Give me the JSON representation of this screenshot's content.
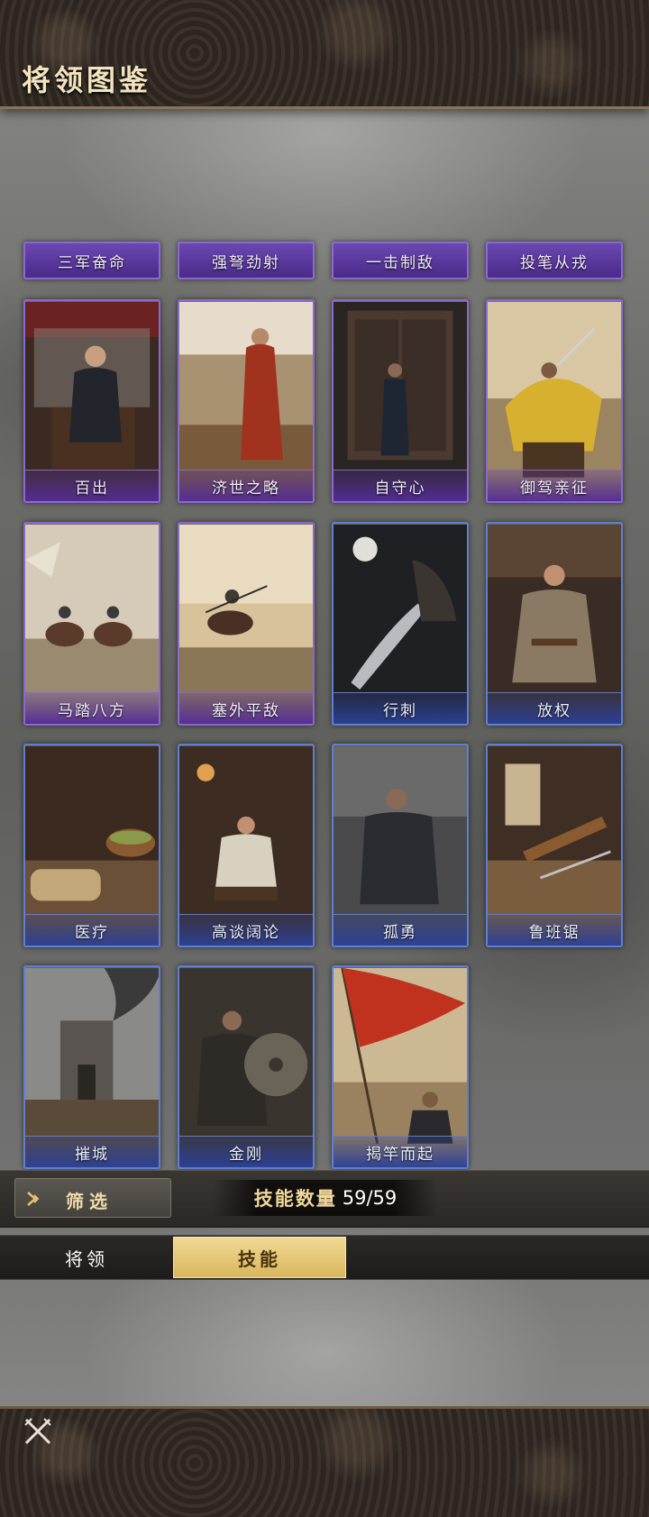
{
  "header": {
    "title": "将领图鉴"
  },
  "skills_partial_row": [
    {
      "name": "三军奋命",
      "tier": "purple"
    },
    {
      "name": "强弩劲射",
      "tier": "purple"
    },
    {
      "name": "一击制敌",
      "tier": "purple"
    },
    {
      "name": "投笔从戎",
      "tier": "purple"
    }
  ],
  "skills": [
    {
      "name": "百出",
      "tier": "purple",
      "art": "general-seated-tent"
    },
    {
      "name": "济世之略",
      "tier": "purple",
      "art": "strategist-overlooking-city"
    },
    {
      "name": "自守心",
      "tier": "purple",
      "art": "figure-before-wooden-door"
    },
    {
      "name": "御驾亲征",
      "tier": "purple",
      "art": "emperor-raising-sword"
    },
    {
      "name": "马踏八方",
      "tier": "purple",
      "art": "cavalry-charge"
    },
    {
      "name": "塞外平敌",
      "tier": "purple",
      "art": "rider-on-frontier"
    },
    {
      "name": "行刺",
      "tier": "blue",
      "art": "assassin-blade-moonlight"
    },
    {
      "name": "放权",
      "tier": "blue",
      "art": "official-in-hall"
    },
    {
      "name": "医疗",
      "tier": "blue",
      "art": "herbs-and-scrolls"
    },
    {
      "name": "高谈阔论",
      "tier": "blue",
      "art": "scholar-debating"
    },
    {
      "name": "孤勇",
      "tier": "blue",
      "art": "lone-warrior"
    },
    {
      "name": "鲁班锯",
      "tier": "blue",
      "art": "carpenter-saw"
    },
    {
      "name": "摧城",
      "tier": "blue",
      "art": "burning-fortress"
    },
    {
      "name": "金刚",
      "tier": "blue",
      "art": "shield-warrior"
    },
    {
      "name": "揭竿而起",
      "tier": "blue",
      "art": "rebel-red-flag"
    }
  ],
  "filter": {
    "label": "筛选",
    "icon": "arrow-right-icon"
  },
  "skill_count": {
    "label": "技能数量",
    "value": "59/59"
  },
  "tabs": [
    {
      "label": "将领",
      "active": false
    },
    {
      "label": "技能",
      "active": true
    }
  ],
  "close": {
    "icon": "crossed-swords-close-icon"
  },
  "colors": {
    "purple_tier": "#6b48b0",
    "blue_tier": "#4a62b8",
    "accent_gold": "#e3c26e",
    "title_text": "#f3e3bf"
  }
}
